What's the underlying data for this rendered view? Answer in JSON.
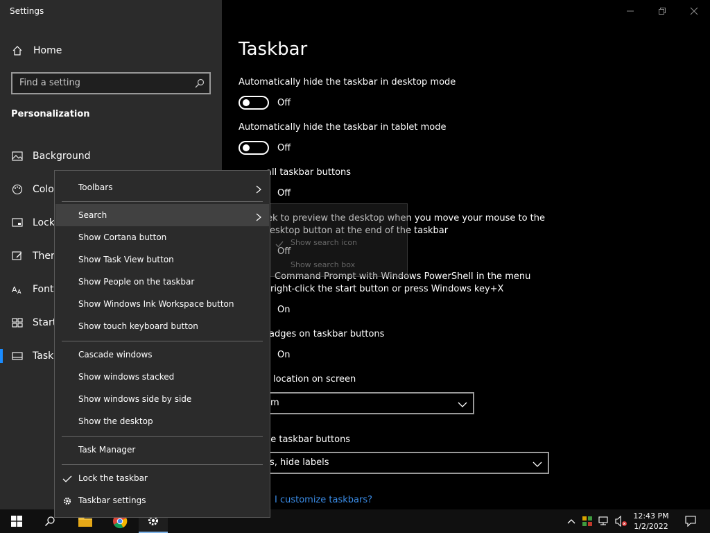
{
  "window": {
    "app_title": "Settings",
    "controls": {
      "minimize_icon": "minimize-icon",
      "maximize_icon": "restore-icon",
      "close_icon": "close-icon"
    }
  },
  "sidebar": {
    "home_label": "Home",
    "search_placeholder": "Find a setting",
    "section_title": "Personalization",
    "items": [
      {
        "label": "Background",
        "icon": "picture-icon"
      },
      {
        "label": "Colo",
        "icon": "palette-icon"
      },
      {
        "label": "Lock",
        "icon": "lock-screen-icon"
      },
      {
        "label": "Ther",
        "icon": "themes-icon"
      },
      {
        "label": "Fonts",
        "icon": "fonts-icon"
      },
      {
        "label": "Start",
        "icon": "start-icon"
      },
      {
        "label": "Taskb",
        "icon": "taskbar-icon"
      }
    ],
    "active_item": "Taskb"
  },
  "content": {
    "title": "Taskbar",
    "settings": [
      {
        "label": "Automatically hide the taskbar in desktop mode",
        "state": "Off"
      },
      {
        "label": "Automatically hide the taskbar in tablet mode",
        "state": "Off"
      },
      {
        "label": "all taskbar buttons",
        "state": "Off"
      },
      {
        "label_line1": "ek to preview the desktop when you move your mouse to the",
        "label_line2": "esktop button at the end of the taskbar",
        "state": "Off"
      },
      {
        "label_line1": "Command Prompt with Windows PowerShell in the menu",
        "label_line2": "right-click the start button or press Windows key+X",
        "state": "On"
      },
      {
        "label": "adges on taskbar buttons",
        "state": "On"
      }
    ],
    "location_label": "location on screen",
    "location_value": "m",
    "combine_label": "he taskbar buttons",
    "combine_value": "s, hide labels",
    "help_link": "I customize taskbars?"
  },
  "context_menu": {
    "items": [
      {
        "label": "Toolbars",
        "submenu": true
      },
      {
        "label": "Search",
        "submenu": true,
        "highlighted": true
      },
      {
        "label": "Show Cortana button"
      },
      {
        "label": "Show Task View button"
      },
      {
        "label": "Show People on the taskbar"
      },
      {
        "label": "Show Windows Ink Workspace button"
      },
      {
        "label": "Show touch keyboard button"
      },
      {
        "label": "Cascade windows"
      },
      {
        "label": "Show windows stacked"
      },
      {
        "label": "Show windows side by side"
      },
      {
        "label": "Show the desktop"
      },
      {
        "label": "Task Manager"
      },
      {
        "label": "Lock the taskbar",
        "checked": true
      },
      {
        "label": "Taskbar settings",
        "icon": "gear-icon"
      }
    ]
  },
  "search_submenu": {
    "items": [
      {
        "label": "Show search icon",
        "checked": true
      },
      {
        "label": "Show search box"
      }
    ]
  },
  "taskbar": {
    "clock_time": "12:43 PM",
    "clock_date": "1/2/2022",
    "colors": {
      "accent": "#0078d7",
      "link": "#3b8eea"
    }
  }
}
